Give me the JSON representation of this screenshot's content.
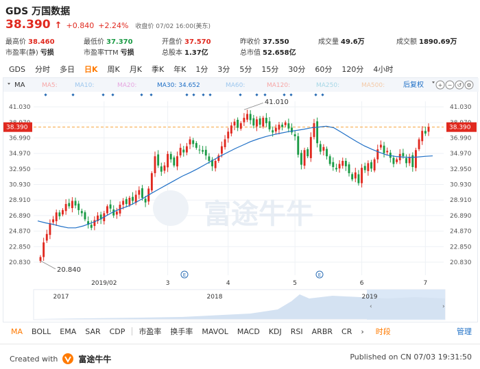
{
  "header": {
    "title": "GDS 万国数据",
    "price": "38.390",
    "change": "+0.840",
    "change_pct": "+2.24%",
    "close_time": "收盘价 07/02 16:00(美东)"
  },
  "stats": {
    "high": {
      "label": "最高价",
      "value": "38.460"
    },
    "low": {
      "label": "最低价",
      "value": "37.370"
    },
    "open": {
      "label": "开盘价",
      "value": "37.570"
    },
    "prev_close": {
      "label": "昨收价",
      "value": "37.550"
    },
    "volume": {
      "label": "成交量",
      "value": "49.6万"
    },
    "turnover": {
      "label": "成交额",
      "value": "1890.69万"
    },
    "pe_static": {
      "label": "市盈率(静)",
      "value": "亏损"
    },
    "pe_ttm": {
      "label": "市盈率TTM",
      "value": "亏损"
    },
    "shares": {
      "label": "总股本",
      "value": "1.37亿"
    },
    "market_cap": {
      "label": "总市值",
      "value": "52.658亿"
    }
  },
  "tabs": [
    {
      "label": "GDS",
      "active": false
    },
    {
      "label": "分时",
      "active": false
    },
    {
      "label": "多日",
      "active": false
    },
    {
      "label": "日K",
      "active": true
    },
    {
      "label": "周K",
      "active": false
    },
    {
      "label": "月K",
      "active": false
    },
    {
      "label": "季K",
      "active": false
    },
    {
      "label": "年K",
      "active": false
    },
    {
      "label": "1分",
      "active": false
    },
    {
      "label": "3分",
      "active": false
    },
    {
      "label": "5分",
      "active": false
    },
    {
      "label": "15分",
      "active": false
    },
    {
      "label": "30分",
      "active": false
    },
    {
      "label": "60分",
      "active": false
    },
    {
      "label": "120分",
      "active": false
    },
    {
      "label": "4小时",
      "active": false
    }
  ],
  "chart_toolbar": {
    "ma_label": "MA",
    "ma_items": [
      {
        "label": "MA5:",
        "color": "#f6a6a6"
      },
      {
        "label": "MA10:",
        "color": "#9dc7ee"
      },
      {
        "label": "MA20:",
        "color": "#e6a6e0"
      },
      {
        "label": "MA30: 34.652",
        "color": "#1e6fc6"
      },
      {
        "label": "MA60:",
        "color": "#9dc7ee"
      },
      {
        "label": "MA120:",
        "color": "#f6a6a6"
      },
      {
        "label": "MA250:",
        "color": "#a6d7e6"
      },
      {
        "label": "MA500:",
        "color": "#f3c9a6"
      }
    ],
    "adjust_label": "后复权"
  },
  "indicators": [
    "MA",
    "BOLL",
    "EMA",
    "SAR",
    "CDP",
    "市盈率",
    "换手率",
    "MAVOL",
    "MACD",
    "KDJ",
    "RSI",
    "ARBR",
    "CR"
  ],
  "indicator_more": "时段",
  "indicator_manage": "管理",
  "footer": {
    "created_with": "Created with",
    "brand": "富途牛牛",
    "published": "Published on CN 07/03 19:31:50"
  },
  "watermark": "富途牛牛",
  "colors": {
    "up": "#e0291f",
    "down": "#1a9a44",
    "ma30": "#1e6fc6",
    "accent": "#ff7a00",
    "current_line": "#f5a23c"
  },
  "chart_data": {
    "type": "candlestick",
    "ylim": [
      20.83,
      43.0
    ],
    "y_ticks": [
      "41.030",
      "38.970",
      "36.990",
      "34.970",
      "32.950",
      "30.930",
      "28.910",
      "26.890",
      "24.870",
      "22.850",
      "20.830"
    ],
    "y_tick_values": [
      41.03,
      38.97,
      36.99,
      34.97,
      32.95,
      30.93,
      28.91,
      26.89,
      24.87,
      22.85,
      20.83
    ],
    "current_price": 38.39,
    "current_price_label": "38.390",
    "max_annotation": {
      "value": 41.01,
      "label": "41.010"
    },
    "min_annotation": {
      "value": 20.84,
      "label": "20.840"
    },
    "x_labels": [
      {
        "label": "2019/02",
        "index": 20
      },
      {
        "label": "3",
        "index": 40
      },
      {
        "label": "4",
        "index": 59
      },
      {
        "label": "5",
        "index": 80
      },
      {
        "label": "6",
        "index": 101
      },
      {
        "label": "7",
        "index": 121
      }
    ],
    "closes": [
      21.5,
      23.4,
      24.5,
      25.9,
      26.4,
      27.3,
      26.8,
      27.6,
      28.4,
      28.1,
      28.8,
      28.2,
      27.6,
      27.2,
      26.4,
      25.7,
      25.3,
      26.3,
      26.9,
      26.4,
      27.2,
      28.1,
      27.8,
      26.9,
      27.4,
      28.3,
      28.8,
      28.4,
      29.2,
      28.8,
      29.6,
      30.2,
      29.2,
      28.6,
      30.4,
      32.4,
      34.6,
      33.4,
      32.6,
      33.4,
      34.9,
      34.2,
      33.4,
      34.6,
      35.7,
      35.1,
      35.9,
      36.8,
      36.2,
      35.7,
      35.4,
      35.2,
      34.7,
      34.0,
      33.3,
      34.0,
      34.7,
      35.9,
      36.8,
      37.8,
      38.6,
      39.1,
      38.3,
      38.9,
      39.6,
      40.1,
      39.3,
      38.6,
      39.4,
      38.7,
      39.6,
      38.9,
      38.1,
      37.7,
      38.3,
      38.7,
      38.4,
      39.0,
      38.2,
      37.7,
      37.2,
      34.8,
      33.5,
      35.4,
      34.6,
      37.1,
      38.9,
      36.3,
      35.2,
      35.8,
      34.6,
      33.6,
      33.2,
      32.9,
      33.6,
      34.0,
      33.3,
      32.4,
      31.6,
      32.5,
      31.1,
      33.1,
      32.8,
      33.7,
      33.0,
      34.2,
      35.5,
      36.1,
      35.0,
      35.3,
      34.4,
      33.6,
      34.2,
      34.9,
      34.6,
      33.7,
      34.5,
      33.2,
      35.4,
      36.8,
      37.9,
      37.55,
      38.39
    ],
    "ma30": [
      26.2,
      25.95,
      25.75,
      25.5,
      25.3,
      25.3,
      25.55,
      25.9,
      26.3,
      26.85,
      27.4,
      27.8,
      28.15,
      28.65,
      29.2,
      29.8,
      30.35,
      30.9,
      31.45,
      32.0,
      32.45,
      32.95,
      33.5,
      34.05,
      34.6,
      35.1,
      35.6,
      36.05,
      36.5,
      36.85,
      37.15,
      37.4,
      37.6,
      37.8,
      37.95,
      38.1,
      38.3,
      38.4,
      38.5,
      38.3,
      37.7,
      37.1,
      36.5,
      35.95,
      35.5,
      35.1,
      34.75,
      34.6,
      34.5,
      34.45,
      34.5,
      34.6,
      34.65
    ]
  }
}
